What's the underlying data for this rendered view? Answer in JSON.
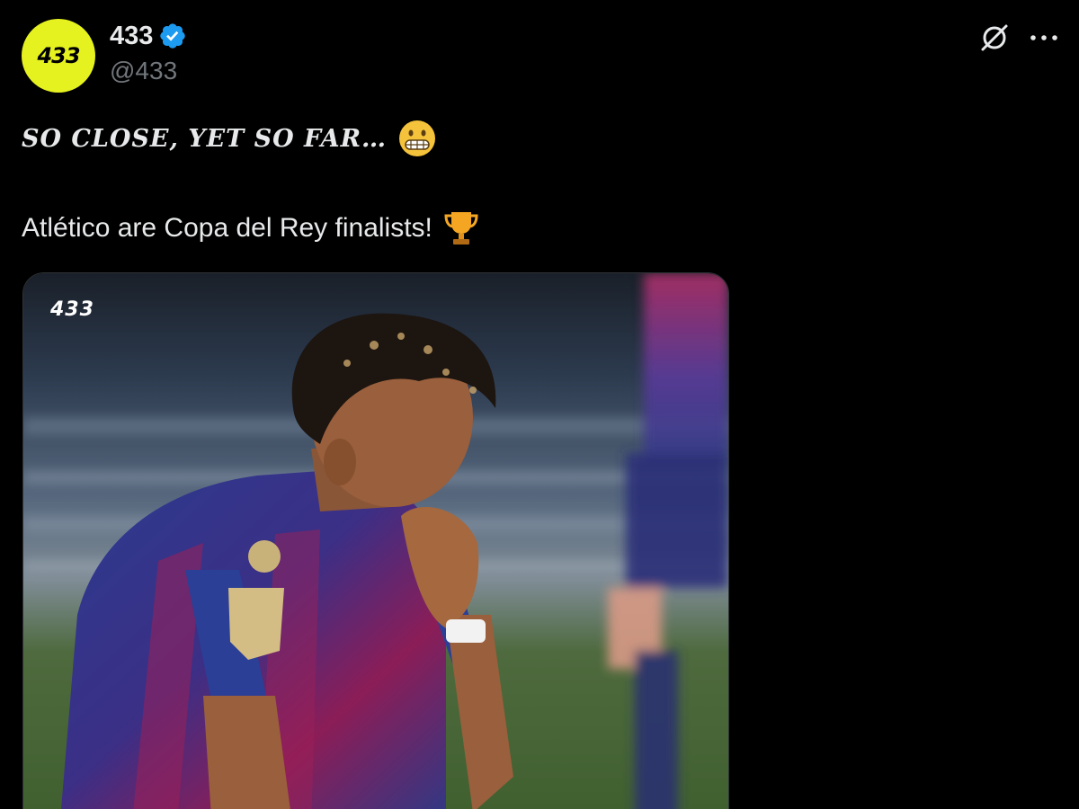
{
  "author": {
    "display_name": "433",
    "handle": "@433",
    "avatar_logo": "433",
    "verified_icon": "verified-badge-icon",
    "accent_color": "#e6f21f",
    "verified_color": "#1d9bf0"
  },
  "actions": {
    "grok_icon": "grok-icon",
    "more_icon": "more-options-icon"
  },
  "tweet": {
    "headline": "SO CLOSE, YET SO FAR…",
    "headline_emoji": "grimacing-face-emoji",
    "body": "Atlético are Copa del Rey finalists!",
    "body_emoji": "trophy-emoji"
  },
  "media": {
    "watermark": "433",
    "description_icon": "photo"
  }
}
